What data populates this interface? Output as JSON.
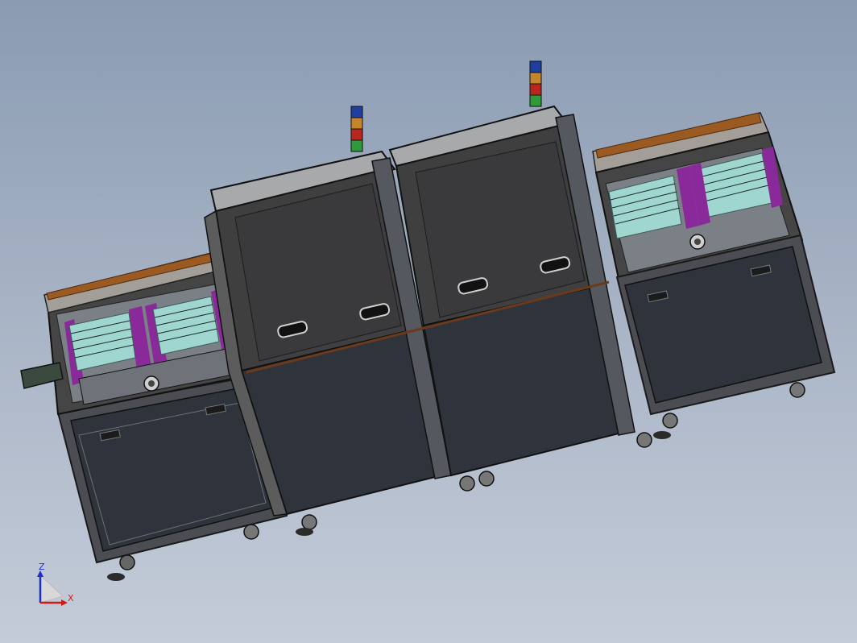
{
  "viewport": {
    "background_top": "#8a9bb2",
    "background_bottom": "#c4ccd8"
  },
  "model": {
    "body_color": "#3f3f3f",
    "frame_color": "#5c5c5c",
    "panel_color": "#2f333c",
    "top_wood_color": "#9b5a22",
    "accent_purple": "#8a2a9a",
    "tray_color": "#9fd6cf"
  },
  "signal_tower": {
    "colors": [
      "#1f3fa0",
      "#c4862a",
      "#b8261e",
      "#2f9a3a"
    ]
  },
  "triad": {
    "z_label": "Z",
    "x_label": "X",
    "z_color": "#1a2fd0",
    "x_color": "#d01a1a",
    "icon": "coordinate-triad-icon"
  }
}
